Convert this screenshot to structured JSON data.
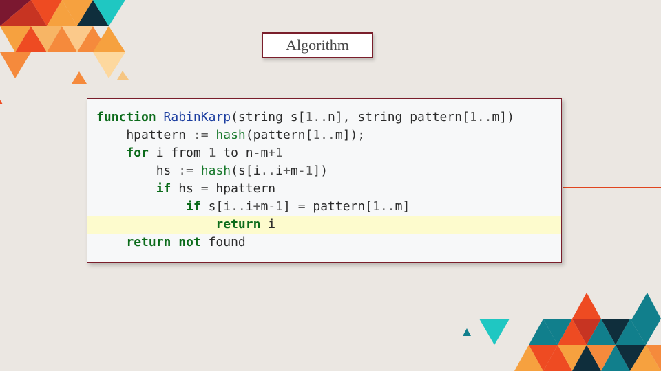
{
  "slide": {
    "title": "Algorithm",
    "colors": {
      "background": "#ebe7e2",
      "frame": "#7a1e2b",
      "accent_line": "#e0451f",
      "highlight": "#fdfbcd",
      "keyword": "#0b6b1a",
      "function_name": "#1c3ea0"
    }
  },
  "code": {
    "highlighted_line": 7,
    "lines": [
      [
        [
          "kw",
          "function"
        ],
        [
          "t",
          " "
        ],
        [
          "fn",
          "RabinKarp"
        ],
        [
          "t",
          "(string s["
        ],
        [
          "num",
          "1"
        ],
        [
          "op",
          ".."
        ],
        [
          "t",
          "n], string pattern["
        ],
        [
          "num",
          "1"
        ],
        [
          "op",
          ".."
        ],
        [
          "t",
          "m])"
        ]
      ],
      [
        [
          "t",
          "    hpattern "
        ],
        [
          "op",
          ":="
        ],
        [
          "t",
          " "
        ],
        [
          "bi",
          "hash"
        ],
        [
          "t",
          "(pattern["
        ],
        [
          "num",
          "1"
        ],
        [
          "op",
          ".."
        ],
        [
          "t",
          "m]);"
        ]
      ],
      [
        [
          "t",
          "    "
        ],
        [
          "kw",
          "for"
        ],
        [
          "t",
          " i from "
        ],
        [
          "num",
          "1"
        ],
        [
          "t",
          " to n"
        ],
        [
          "op",
          "-"
        ],
        [
          "t",
          "m"
        ],
        [
          "op",
          "+"
        ],
        [
          "num",
          "1"
        ]
      ],
      [
        [
          "t",
          "        hs "
        ],
        [
          "op",
          ":="
        ],
        [
          "t",
          " "
        ],
        [
          "bi",
          "hash"
        ],
        [
          "t",
          "(s[i"
        ],
        [
          "op",
          ".."
        ],
        [
          "t",
          "i"
        ],
        [
          "op",
          "+"
        ],
        [
          "t",
          "m"
        ],
        [
          "op",
          "-"
        ],
        [
          "num",
          "1"
        ],
        [
          "t",
          "])"
        ]
      ],
      [
        [
          "t",
          "        "
        ],
        [
          "kw",
          "if"
        ],
        [
          "t",
          " hs "
        ],
        [
          "op",
          "="
        ],
        [
          "t",
          " hpattern"
        ]
      ],
      [
        [
          "t",
          "            "
        ],
        [
          "kw",
          "if"
        ],
        [
          "t",
          " s[i"
        ],
        [
          "op",
          ".."
        ],
        [
          "t",
          "i"
        ],
        [
          "op",
          "+"
        ],
        [
          "t",
          "m"
        ],
        [
          "op",
          "-"
        ],
        [
          "num",
          "1"
        ],
        [
          "t",
          "] "
        ],
        [
          "op",
          "="
        ],
        [
          "t",
          " pattern["
        ],
        [
          "num",
          "1"
        ],
        [
          "op",
          ".."
        ],
        [
          "t",
          "m]"
        ]
      ],
      [
        [
          "t",
          "                "
        ],
        [
          "kw",
          "return"
        ],
        [
          "t",
          " i"
        ]
      ],
      [
        [
          "t",
          "    "
        ],
        [
          "kw",
          "return"
        ],
        [
          "t",
          " "
        ],
        [
          "kw",
          "not"
        ],
        [
          "t",
          " found"
        ]
      ]
    ]
  }
}
